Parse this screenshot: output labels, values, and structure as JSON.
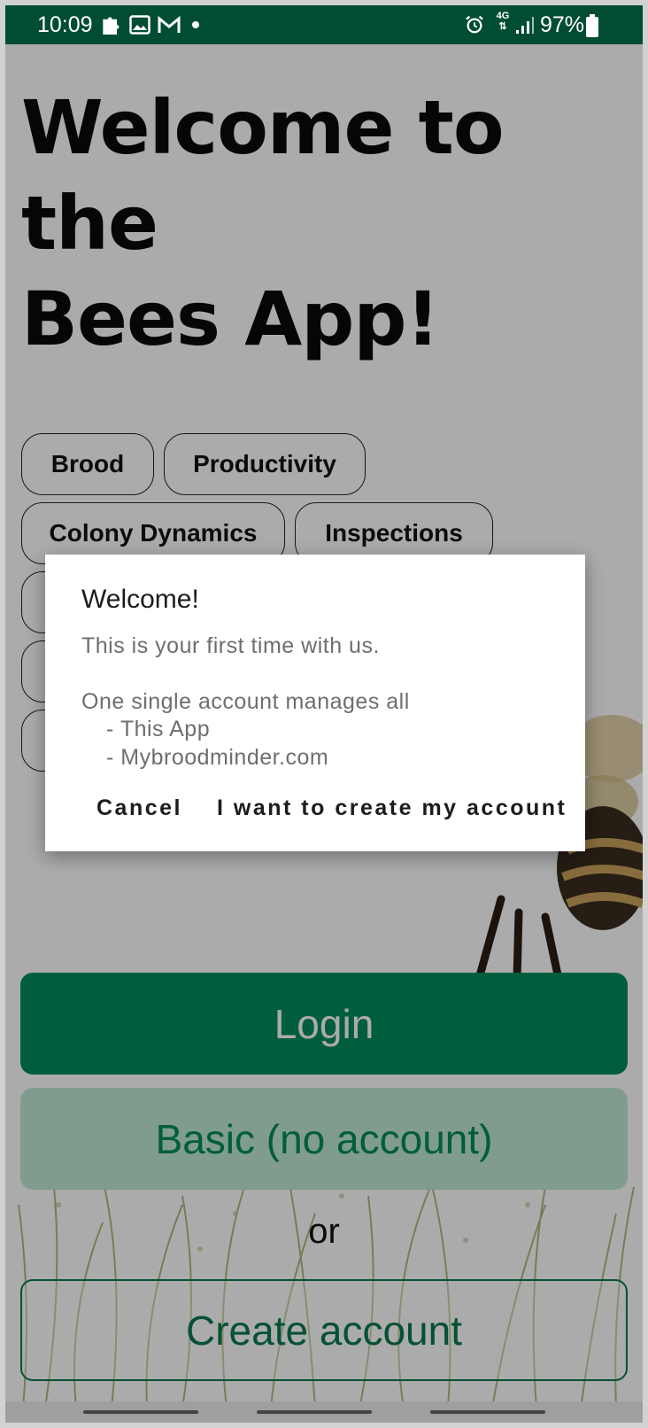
{
  "status_bar": {
    "time": "10:09",
    "left_icons": [
      "puzzle-icon",
      "image-icon",
      "gmail-icon",
      "dot-icon"
    ],
    "right_icons": [
      "alarm-icon",
      "network-4g-icon",
      "signal-icon",
      "battery-icon"
    ],
    "network_label": "4G",
    "battery": "97%"
  },
  "page": {
    "title_line1": "Welcome to the",
    "title_line2": "Bees App!",
    "chips": [
      "Brood",
      "Productivity",
      "Colony Dynamics",
      "Inspections"
    ],
    "login_label": "Login",
    "basic_label": "Basic (no account)",
    "or_label": "or",
    "create_label": "Create account"
  },
  "dialog": {
    "title": "Welcome!",
    "line1": "This is your first time with us.",
    "line2": "One single account manages all",
    "bullet1": "- This App",
    "bullet2": "- Mybroodminder.com",
    "cancel_label": "Cancel",
    "confirm_label": "I want to create my account"
  },
  "colors": {
    "status_bar": "#004d33",
    "primary": "#008b5c",
    "secondary_bg": "#bfe9d4"
  }
}
